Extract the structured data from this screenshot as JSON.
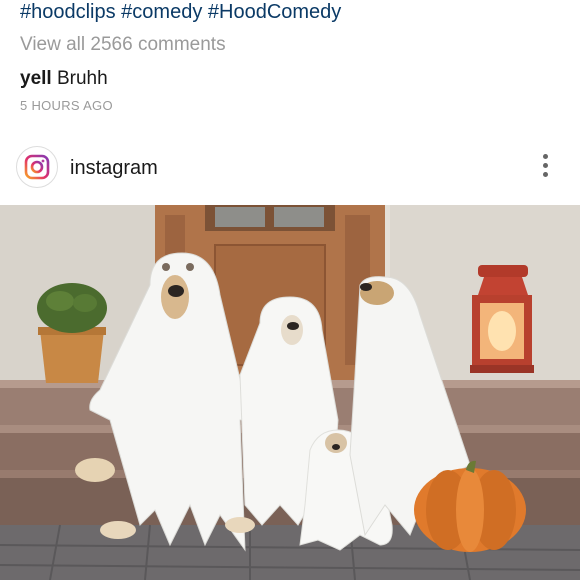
{
  "caption": {
    "hashtags": "#hoodclips #comedy #HoodComedy"
  },
  "comments": {
    "view_all_label": "View all 2566 comments",
    "items": [
      {
        "user": "yell",
        "text": "Bruhh"
      }
    ]
  },
  "timestamp": "5 HOURS AGO",
  "post": {
    "username": "instagram",
    "avatar_icon": "instagram-logo-icon",
    "more_icon": "more-vertical-icon",
    "image_subject": "four dogs dressed as ghosts on stone steps with a pumpkin and lantern"
  },
  "colors": {
    "hashtag": "#0b3a66",
    "muted": "#9a9a9a",
    "text": "#1a1a1a"
  }
}
